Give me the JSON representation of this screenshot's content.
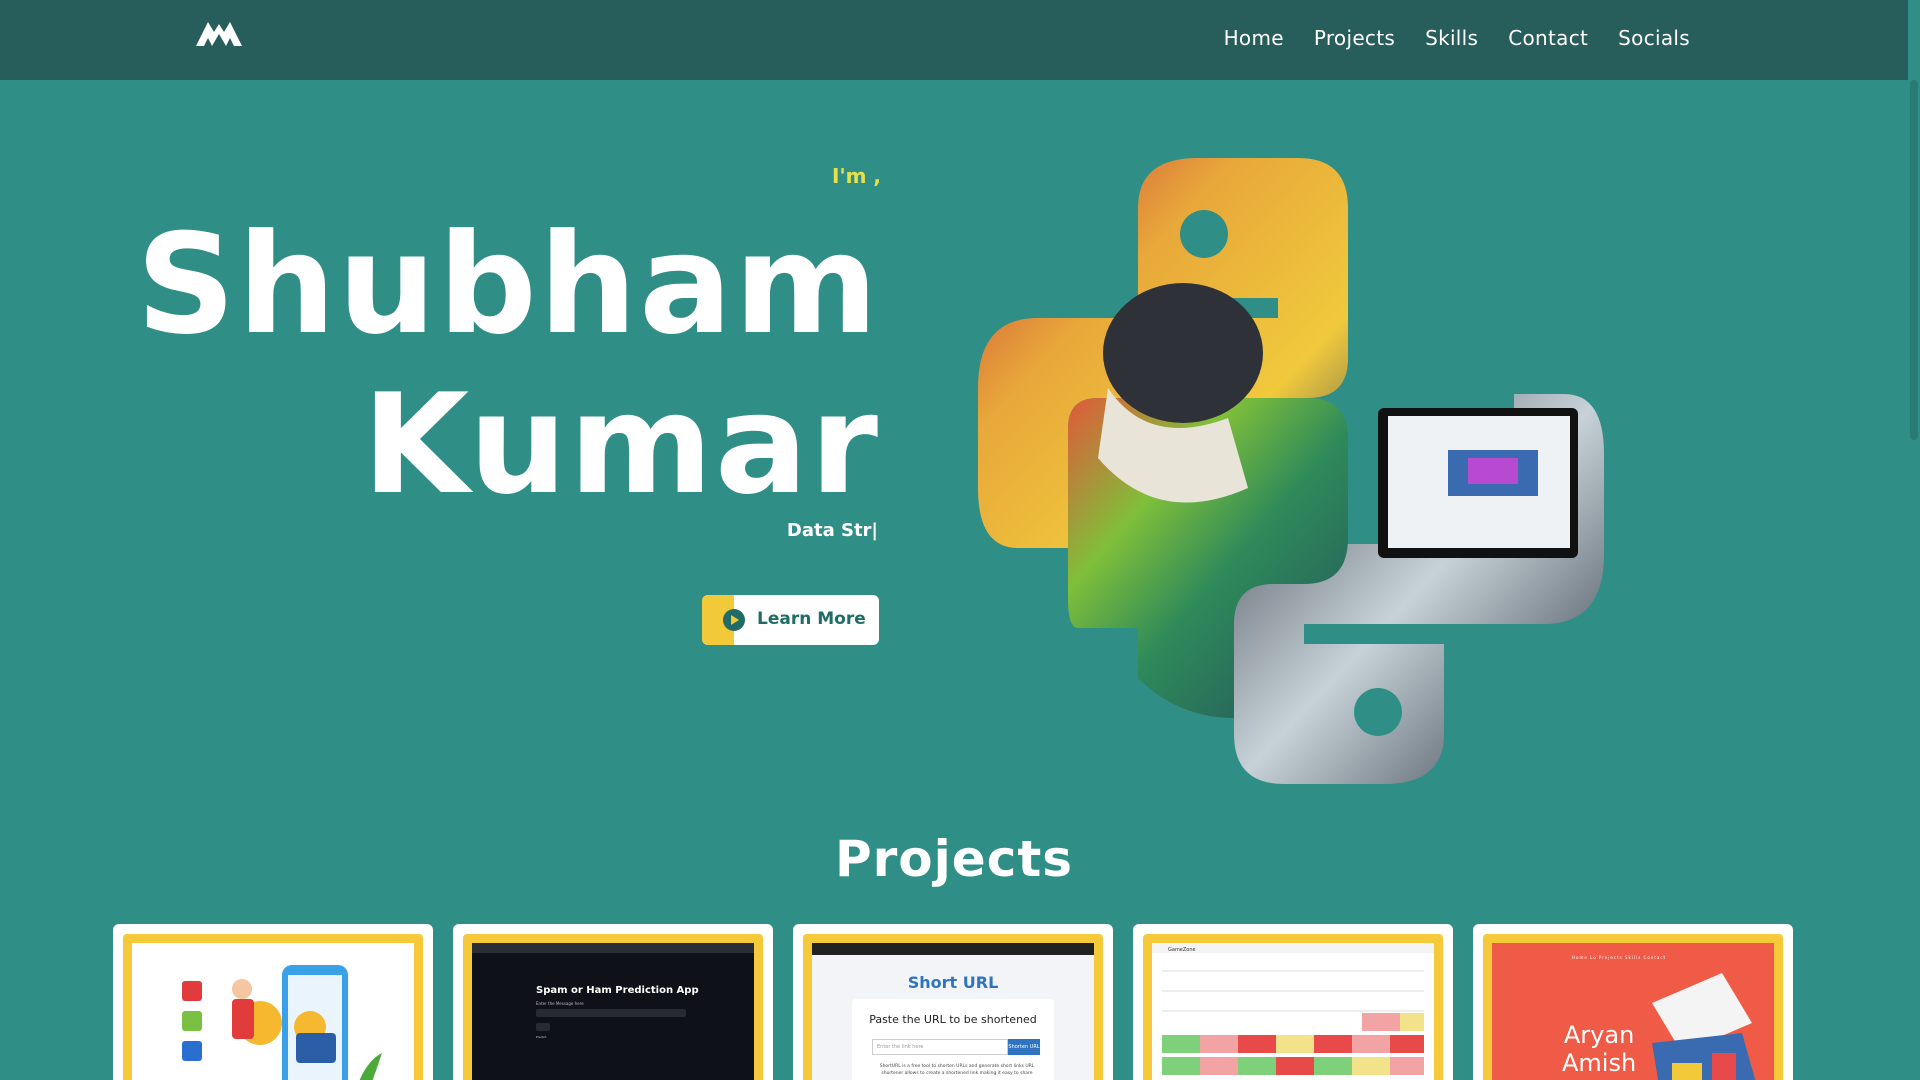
{
  "nav": {
    "logo_icon": "mountain-logo-icon",
    "links": [
      "Home",
      "Projects",
      "Skills",
      "Contact",
      "Socials"
    ]
  },
  "hero": {
    "intro": "I'm ,",
    "first_name": "Shubham",
    "last_name": "Kumar",
    "typed_text": "Data Str|",
    "button_label": "Learn More",
    "button_icon": "play-circle-icon"
  },
  "projects": {
    "title": "Projects",
    "cards": [
      {
        "thumb": "crypto-wallet-illustration"
      },
      {
        "thumb": "spam-ham-app",
        "app_title": "Spam or Ham Prediction App",
        "sub": "Enter the Message here",
        "btn": "Predict"
      },
      {
        "thumb": "short-url-app",
        "app_title": "Short URL",
        "paste": "Paste the URL to be shortened",
        "placeholder": "Enter the link here",
        "button": "Shorten URL",
        "desc": "ShortURL is a free tool to shorten URLs and generate short links URL shortener allows to create a shortened link making it easy to share"
      },
      {
        "thumb": "calendar-app",
        "brand": "GameZone"
      },
      {
        "thumb": "portfolio-site",
        "name_line1": "Aryan",
        "name_line2": "Amish",
        "nav": "Home  Lo Projects  Skills  Contact"
      }
    ]
  },
  "colors": {
    "background": "#2f8f86",
    "navbar": "#275d5a",
    "accent_yellow": "#f2c938",
    "intro_yellow": "#e8e04a",
    "text": "#ffffff"
  }
}
